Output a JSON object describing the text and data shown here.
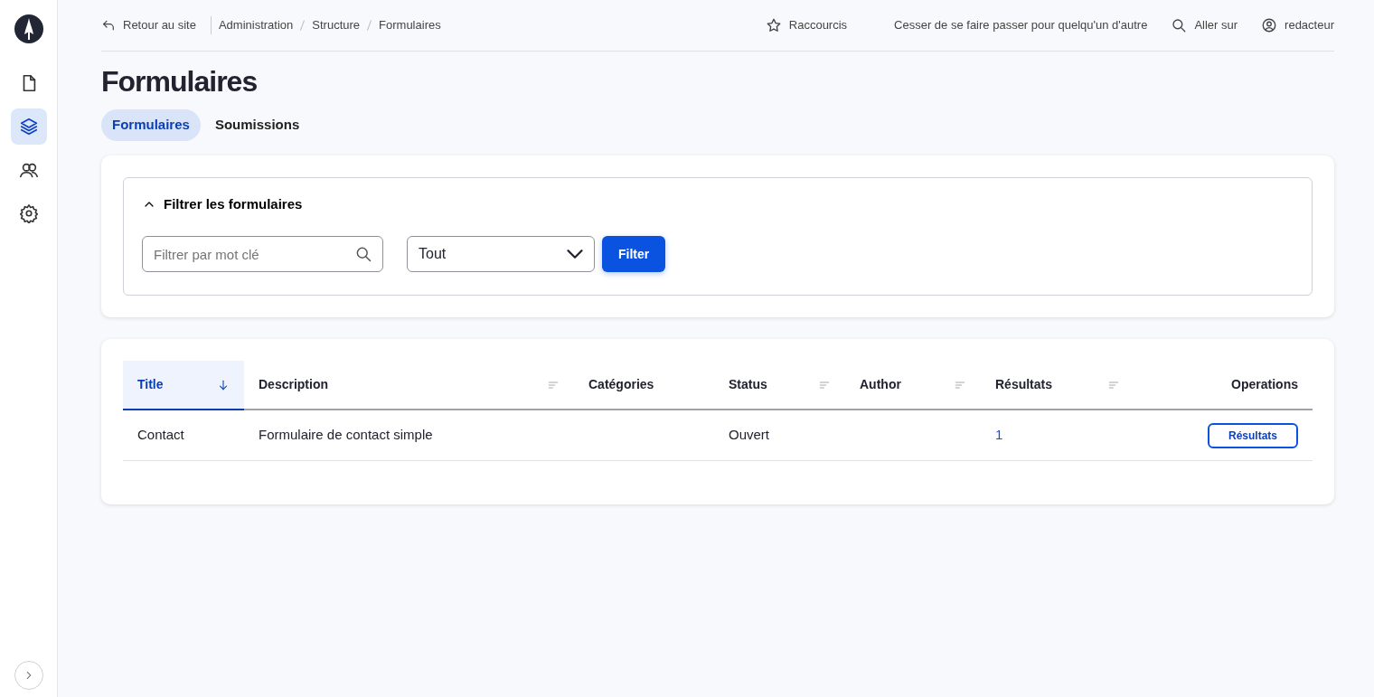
{
  "sidebar": {
    "items": [
      {
        "kind": "document",
        "selected": false
      },
      {
        "kind": "layers",
        "selected": true
      },
      {
        "kind": "people",
        "selected": false
      },
      {
        "kind": "gear",
        "selected": false
      }
    ]
  },
  "topbar": {
    "back_link": "Retour au site",
    "breadcrumb": [
      "Administration",
      "Structure",
      "Formulaires"
    ],
    "actions": [
      {
        "kind": "star",
        "label": "Raccourcis"
      },
      {
        "kind": "text",
        "label": "Cesser de se faire passer pour quelqu'un d'autre"
      },
      {
        "kind": "search",
        "label": "Aller sur"
      },
      {
        "kind": "user",
        "label": "redacteur"
      }
    ]
  },
  "title": "Formulaires",
  "tabs": [
    {
      "label": "Formulaires",
      "selected": true
    },
    {
      "label": "Soumissions",
      "selected": false
    }
  ],
  "filter": {
    "title": "Filtrer les formulaires",
    "expanded": true,
    "search": {
      "placeholder": "Filtrer par mot clé"
    },
    "select": {
      "value": "Tout"
    },
    "button": "Filter"
  },
  "table": {
    "columns": [
      {
        "label": "Title",
        "sortable": true,
        "sorted": true
      },
      {
        "label": "Description",
        "sortable": true,
        "sorted": false
      },
      {
        "label": "Catégories",
        "sortable": false,
        "sorted": false
      },
      {
        "label": "Status",
        "sortable": true,
        "sorted": false
      },
      {
        "label": "Author",
        "sortable": true,
        "sorted": false
      },
      {
        "label": "Résultats",
        "sortable": true,
        "sorted": false
      },
      {
        "label": "Operations",
        "sortable": false,
        "sorted": false
      }
    ],
    "rows": [
      {
        "cells": [
          {
            "kind": "text",
            "text": "Contact"
          },
          {
            "kind": "text",
            "text": "Formulaire de contact simple"
          },
          {
            "kind": "empty"
          },
          {
            "kind": "text",
            "text": "Ouvert"
          },
          {
            "kind": "empty"
          },
          {
            "kind": "link",
            "text": "1"
          },
          {
            "kind": "button",
            "text": "Résultats"
          }
        ]
      }
    ]
  }
}
